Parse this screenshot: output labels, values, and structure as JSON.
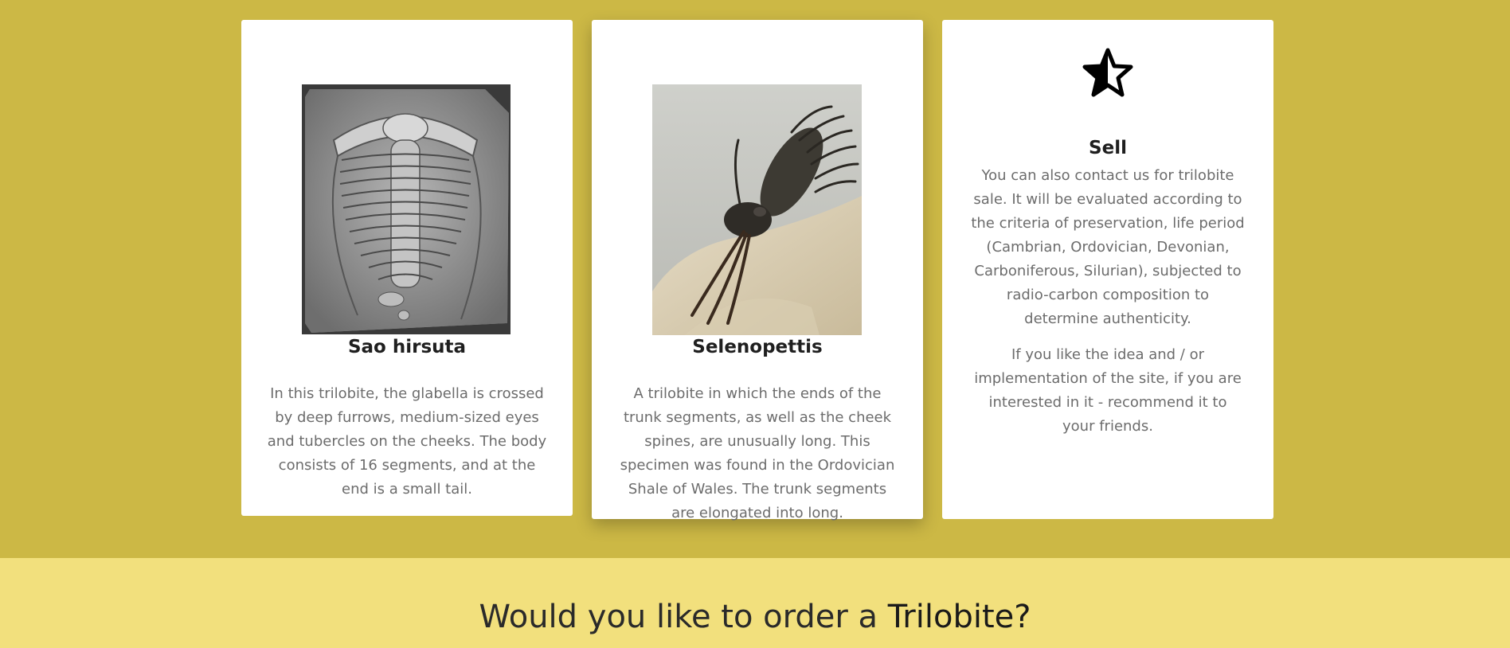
{
  "cards": [
    {
      "title": "Sao hirsuta",
      "text": "In this trilobite, the glabella is crossed by deep furrows, medium-sized eyes and tubercles on the cheeks. The body consists of 16 segments, and at the end is a small tail."
    },
    {
      "title": "Selenopettis",
      "text": "A trilobite in which the ends of the trunk segments, as well as the cheek spines, are unusually long. This specimen was found in the Ordovician Shale of Wales. The trunk segments are elongated into long."
    },
    {
      "icon": "star-half-icon",
      "title": "Sell",
      "text1": "You can also contact us for trilobite sale. It will be evaluated according to the criteria of preservation, life period (Cambrian, Ordovician, Devonian, Carboniferous, Silurian), subjected to radio-carbon composition to determine authenticity.",
      "text2": "If you like the idea and / or implementation of the site, if you are interested in it - recommend it to your friends."
    }
  ],
  "order": {
    "heading_prefix": "Would you like to order a ",
    "heading_emphasis": "Trilobite?"
  },
  "colors": {
    "top_background": "#ccb845",
    "bottom_background": "#f2e07d",
    "card_background": "#ffffff"
  }
}
